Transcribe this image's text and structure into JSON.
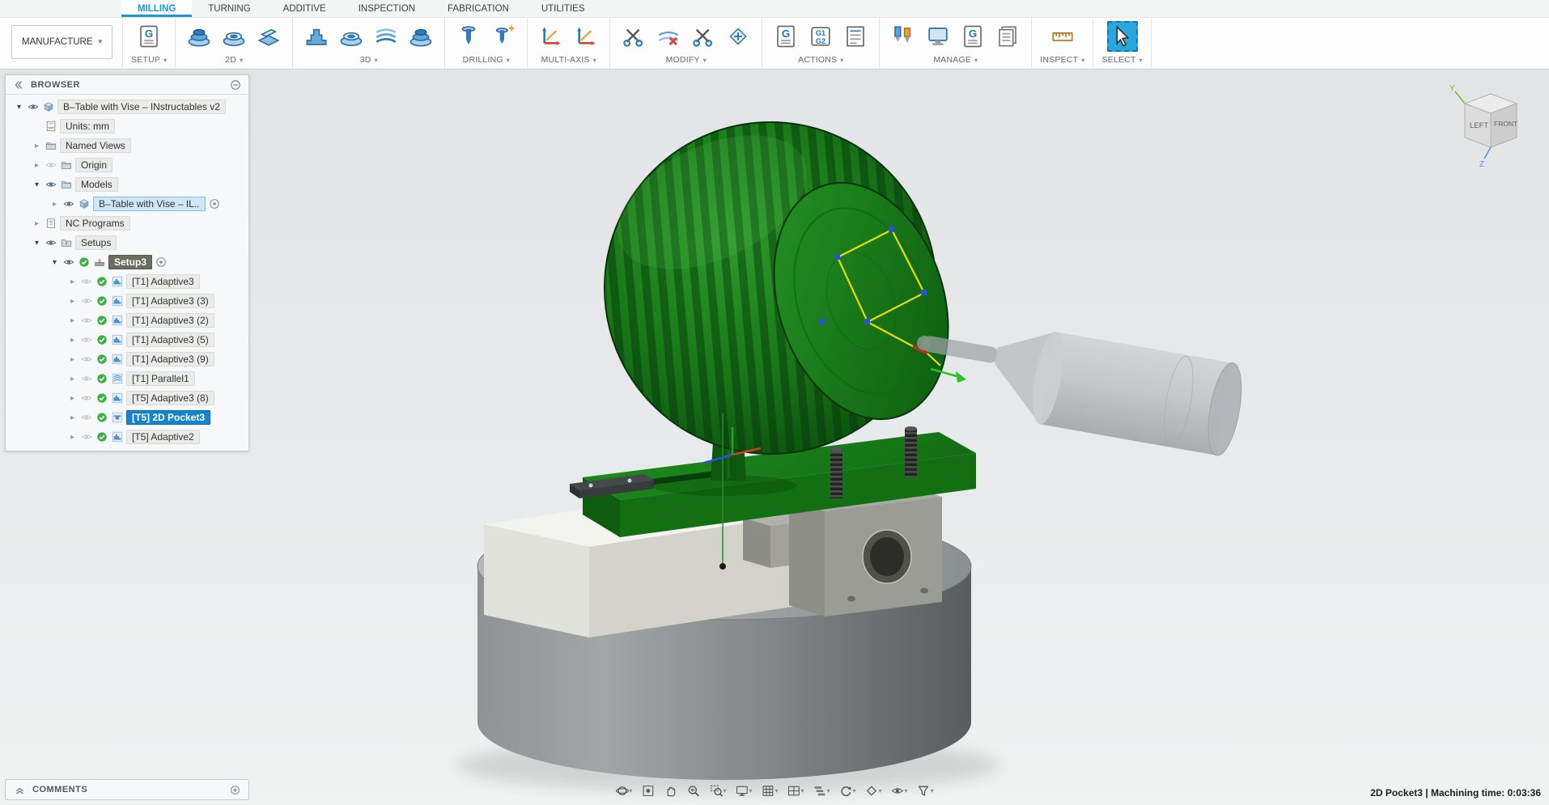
{
  "glyphs": {
    "expanded": "▾",
    "collapsed": "▸",
    "caret": "▾"
  },
  "workspace": {
    "label": "MANUFACTURE"
  },
  "tabs": [
    {
      "label": "MILLING",
      "active": true
    },
    {
      "label": "TURNING",
      "active": false
    },
    {
      "label": "ADDITIVE",
      "active": false
    },
    {
      "label": "INSPECTION",
      "active": false
    },
    {
      "label": "FABRICATION",
      "active": false
    },
    {
      "label": "UTILITIES",
      "active": false
    }
  ],
  "ribbon": {
    "groups": [
      {
        "label": "SETUP",
        "icons": [
          {
            "name": "new-setup",
            "glyph": "doc_g"
          }
        ]
      },
      {
        "label": "2D",
        "icons": [
          {
            "name": "2d-adaptive",
            "glyph": "disks"
          },
          {
            "name": "2d-pocket",
            "glyph": "disks2"
          },
          {
            "name": "face",
            "glyph": "plane"
          }
        ]
      },
      {
        "label": "3D",
        "icons": [
          {
            "name": "adaptive-clearing",
            "glyph": "terraces"
          },
          {
            "name": "pocket-clearing",
            "glyph": "disks2"
          },
          {
            "name": "parallel",
            "glyph": "stripes"
          },
          {
            "name": "scallop",
            "glyph": "disks"
          }
        ]
      },
      {
        "label": "DRILLING",
        "icons": [
          {
            "name": "drill",
            "glyph": "drill"
          },
          {
            "name": "thread",
            "glyph": "drill2"
          }
        ]
      },
      {
        "label": "MULTI-AXIS",
        "icons": [
          {
            "name": "swarf",
            "glyph": "axes"
          },
          {
            "name": "multi-axis-contour",
            "glyph": "axes"
          }
        ]
      },
      {
        "label": "MODIFY",
        "icons": [
          {
            "name": "trim-toolpath",
            "glyph": "scissors"
          },
          {
            "name": "delete-passes",
            "glyph": "redx"
          },
          {
            "name": "offset-passes",
            "glyph": "scissors"
          },
          {
            "name": "edit-passes",
            "glyph": "diamondplus"
          }
        ]
      },
      {
        "label": "ACTIONS",
        "icons": [
          {
            "name": "post-process",
            "glyph": "doc_g"
          },
          {
            "name": "generate-gcode",
            "glyph": "g1g2"
          },
          {
            "name": "setup-sheet",
            "glyph": "listdoc"
          }
        ]
      },
      {
        "label": "MANAGE",
        "icons": [
          {
            "name": "tool-library",
            "glyph": "tools"
          },
          {
            "name": "machine-library",
            "glyph": "monitor"
          },
          {
            "name": "post-library",
            "glyph": "doc_g"
          },
          {
            "name": "templates",
            "glyph": "sheets"
          }
        ]
      },
      {
        "label": "INSPECT",
        "icons": [
          {
            "name": "measure",
            "glyph": "ruler"
          }
        ]
      },
      {
        "label": "SELECT",
        "icons": [
          {
            "name": "select",
            "glyph": "cursor",
            "active": true
          }
        ]
      }
    ]
  },
  "browser": {
    "title": "BROWSER",
    "rows": [
      {
        "label": "B–Table with Vise – INstructables v2",
        "level": 0,
        "arrow": "exp",
        "eye": "on",
        "icon": "component",
        "style": "plain"
      },
      {
        "label": "Units: mm",
        "level": 1,
        "arrow": null,
        "eye": null,
        "icon": "units",
        "style": "plain"
      },
      {
        "label": "Named Views",
        "level": 1,
        "arrow": "col",
        "eye": null,
        "icon": "folder",
        "style": "plain"
      },
      {
        "label": "Origin",
        "level": 1,
        "arrow": "col",
        "eye": "off",
        "icon": "folder",
        "style": "plain"
      },
      {
        "label": "Models",
        "level": 1,
        "arrow": "exp",
        "eye": "on",
        "icon": "folder",
        "style": "plain"
      },
      {
        "label": "B–Table with Vise – IL..",
        "level": 2,
        "arrow": "col",
        "eye": "on",
        "icon": "component",
        "style": "hilite",
        "radio": true
      },
      {
        "label": "NC Programs",
        "level": 1,
        "arrow": "col",
        "eye": null,
        "icon": "nc",
        "style": "plain"
      },
      {
        "label": "Setups",
        "level": 1,
        "arrow": "exp",
        "eye": "on",
        "icon": "setups",
        "style": "plain"
      },
      {
        "label": "Setup3",
        "level": 2,
        "arrow": "exp",
        "eye": "on",
        "check": true,
        "icon": "setup",
        "style": "badge",
        "radio": true
      },
      {
        "label": "[T1] Adaptive3",
        "level": 3,
        "arrow": "col",
        "eye": "off",
        "check": true,
        "icon": "op_adaptive",
        "style": "plain"
      },
      {
        "label": "[T1] Adaptive3 (3)",
        "level": 3,
        "arrow": "col",
        "eye": "off",
        "check": true,
        "icon": "op_adaptive",
        "style": "plain"
      },
      {
        "label": "[T1] Adaptive3 (2)",
        "level": 3,
        "arrow": "col",
        "eye": "off",
        "check": true,
        "icon": "op_adaptive",
        "style": "plain"
      },
      {
        "label": "[T1] Adaptive3 (5)",
        "level": 3,
        "arrow": "col",
        "eye": "off",
        "check": true,
        "icon": "op_adaptive",
        "style": "plain"
      },
      {
        "label": "[T1] Adaptive3 (9)",
        "level": 3,
        "arrow": "col",
        "eye": "off",
        "check": true,
        "icon": "op_adaptive",
        "style": "plain"
      },
      {
        "label": "[T1] Parallel1",
        "level": 3,
        "arrow": "col",
        "eye": "off",
        "check": true,
        "icon": "op_parallel",
        "style": "plain"
      },
      {
        "label": "[T5] Adaptive3 (8)",
        "level": 3,
        "arrow": "col",
        "eye": "off",
        "check": true,
        "icon": "op_adaptive",
        "style": "plain"
      },
      {
        "label": "[T5] 2D Pocket3",
        "level": 3,
        "arrow": "col",
        "eye": "off",
        "check": true,
        "icon": "op_pocket",
        "style": "selected"
      },
      {
        "label": "[T5] Adaptive2",
        "level": 3,
        "arrow": "col",
        "eye": "off",
        "check": true,
        "icon": "op_adaptive",
        "style": "plain"
      }
    ]
  },
  "comments": {
    "title": "COMMENTS"
  },
  "navbar": {
    "items": [
      {
        "name": "orbit",
        "glyph": "orbit",
        "caret": true
      },
      {
        "name": "look-at",
        "glyph": "lookat",
        "caret": false
      },
      {
        "name": "pan",
        "glyph": "hand",
        "caret": false
      },
      {
        "name": "zoom",
        "glyph": "zoom",
        "caret": false
      },
      {
        "name": "zoom-window",
        "glyph": "zoomwin",
        "caret": true
      },
      {
        "name": "display-settings",
        "glyph": "monitor16",
        "caret": true
      },
      {
        "name": "grid-and-snaps",
        "glyph": "grid",
        "caret": true
      },
      {
        "name": "viewports",
        "glyph": "viewports",
        "caret": true
      },
      {
        "name": "action-sets",
        "glyph": "steps",
        "caret": true
      },
      {
        "name": "turntable",
        "glyph": "refresh",
        "caret": true
      },
      {
        "name": "effects",
        "glyph": "diamond",
        "caret": true
      },
      {
        "name": "visibility",
        "glyph": "eye16",
        "caret": true
      },
      {
        "name": "selection-filter",
        "glyph": "filter",
        "caret": true
      }
    ]
  },
  "statusbar": {
    "text": "2D Pocket3 | Machining time: 0:03:36"
  },
  "viewcube": {
    "left": "LEFT",
    "front": "FRONT",
    "axis_y": "Y",
    "axis_z": "Z"
  }
}
